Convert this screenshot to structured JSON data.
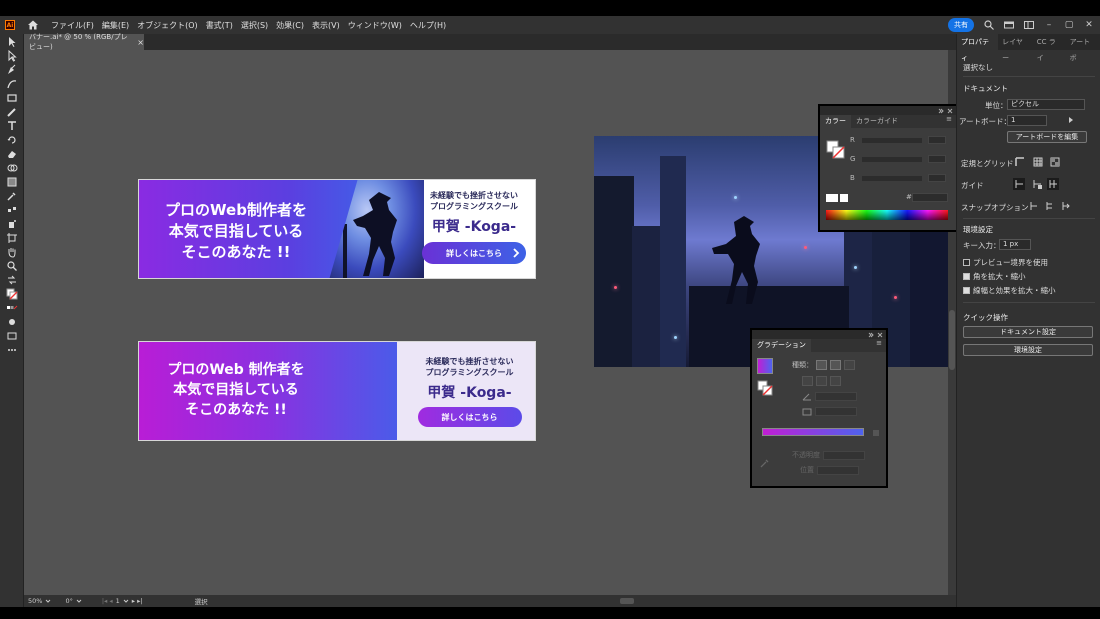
{
  "menubar": {
    "app_logo": "Ai",
    "items": [
      "ファイル(F)",
      "編集(E)",
      "オブジェクト(O)",
      "書式(T)",
      "選択(S)",
      "効果(C)",
      "表示(V)",
      "ウィンドウ(W)",
      "ヘルプ(H)"
    ],
    "share_label": "共有",
    "window_buttons": [
      "–",
      "▢",
      "✕"
    ]
  },
  "document_tab": {
    "title": "バナー.ai* @ 50 % (RGB/プレビュー)",
    "close": "×"
  },
  "banner1": {
    "headline": [
      "プロのWeb制作者を",
      "本気で目指している",
      "そこのあなた !!"
    ],
    "sub": [
      "未経験でも挫折させない",
      "プログラミングスクール"
    ],
    "brand": "甲賀 -Koga-",
    "cta": "詳しくはこちら"
  },
  "banner2": {
    "headline": [
      "プロのWeb 制作者を",
      "本気で目指している",
      "そこのあなた !!"
    ],
    "sub": [
      "未経験でも挫折させない",
      "プログラミングスクール"
    ],
    "brand": "甲賀 -Koga-",
    "cta": "詳しくはこちら"
  },
  "color_panel": {
    "tabs": [
      "カラー",
      "カラーガイド"
    ],
    "channels": [
      "R",
      "G",
      "B"
    ],
    "hash": "#"
  },
  "gradient_panel": {
    "tab": "グラデーション",
    "type_label": "種類：",
    "opacity_label": "不透明度",
    "location_label": "位置",
    "colors": {
      "start": "#c21ed4",
      "end": "#4e63ee"
    }
  },
  "properties": {
    "tabs": [
      "プロパティ",
      "レイヤー",
      "CC ライ",
      "アートボ"
    ],
    "no_selection": "選択なし",
    "document_heading": "ドキュメント",
    "units_label": "単位：",
    "units_value": "ピクセル",
    "artboard_label": "アートボード：",
    "artboard_value": "1",
    "edit_artboards": "アートボードを編集",
    "rulers_grids": "定規とグリッド",
    "guides": "ガイド",
    "snap_options": "スナップオプション",
    "preferences_heading": "環境設定",
    "keyboard_increment_label": "キー入力：",
    "keyboard_increment_value": "1 px",
    "use_preview_bounds": "プレビュー境界を使用",
    "scale_corners": "角を拡大・縮小",
    "scale_strokes": "線幅と効果を拡大・縮小",
    "quick_actions_heading": "クイック操作",
    "doc_setup_button": "ドキュメント設定",
    "preferences_button": "環境設定"
  },
  "statusbar": {
    "zoom": "50%",
    "rotation": "0°",
    "artboard": "1",
    "tool": "選択"
  }
}
